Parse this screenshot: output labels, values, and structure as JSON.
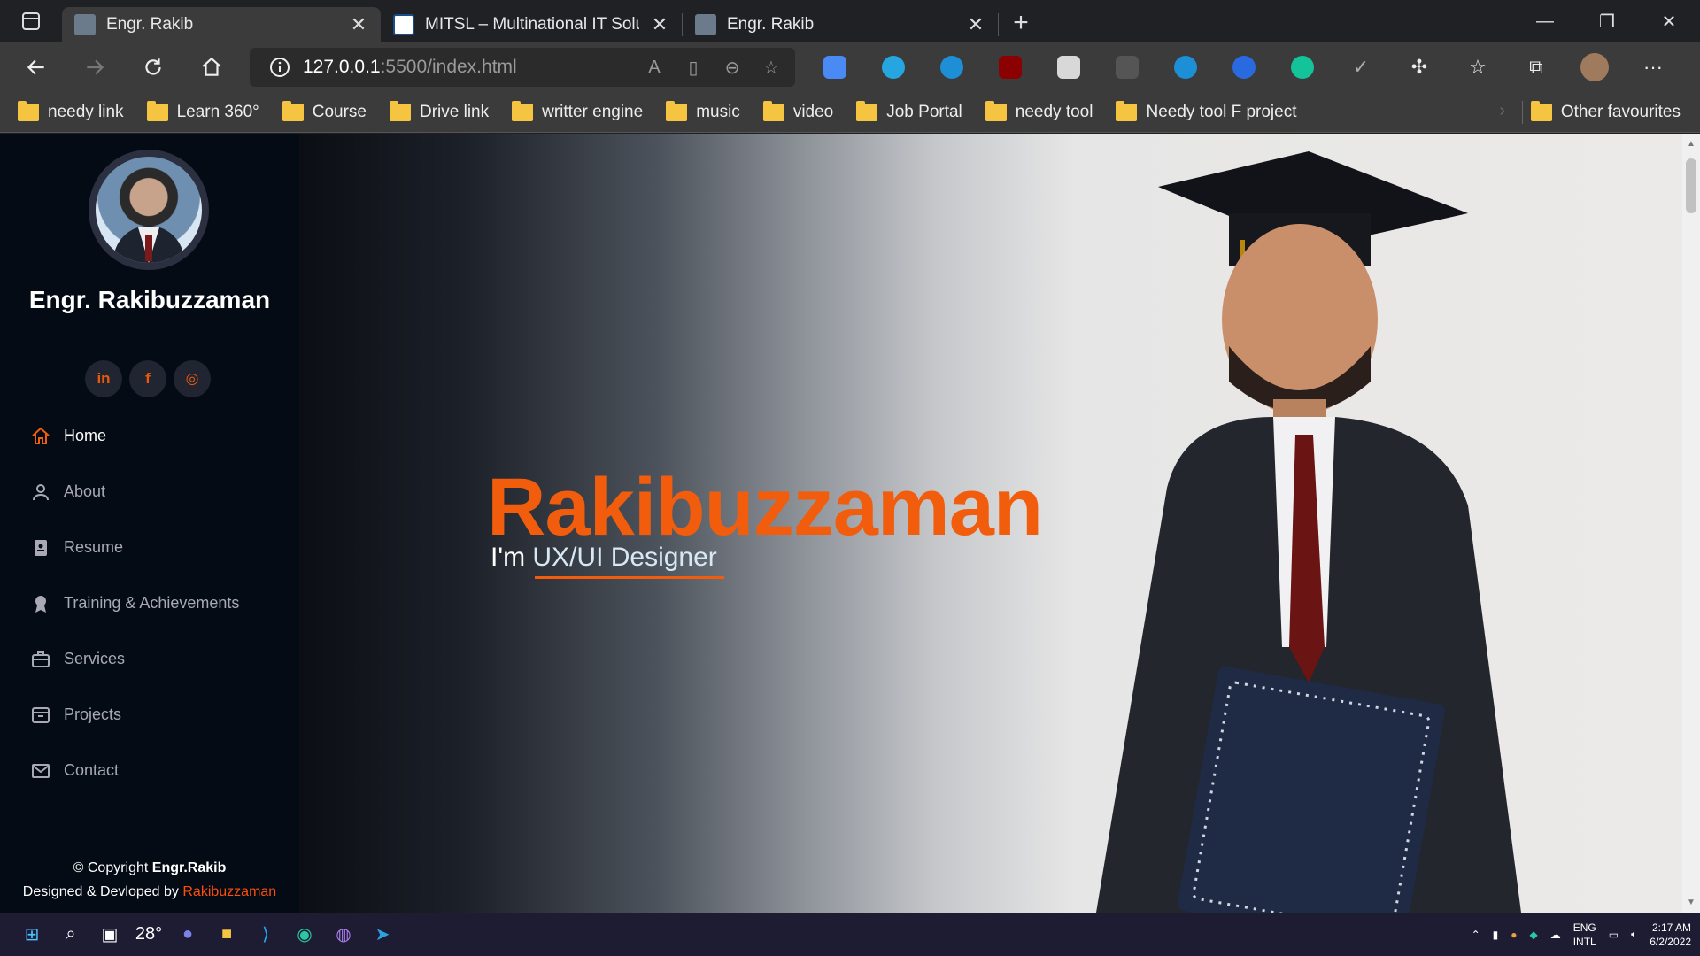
{
  "browser": {
    "tabs": [
      {
        "title": "Engr. Rakib",
        "active": true
      },
      {
        "title": "MITSL – Multinational IT Solution",
        "active": false
      },
      {
        "title": "Engr. Rakib",
        "active": false
      }
    ],
    "url_host": "127.0.0.1",
    "url_rest": ":5500/index.html",
    "bookmarks": [
      "needy link",
      "Learn 360°",
      "Course",
      "Drive link",
      "writter engine",
      "music",
      "video",
      "Job Portal",
      "needy tool",
      "Needy tool F project"
    ],
    "other_favourites": "Other favourites"
  },
  "sidebar": {
    "name": "Engr. Rakibuzzaman",
    "socials": [
      {
        "icon": "linkedin-icon",
        "glyph": "in"
      },
      {
        "icon": "facebook-icon",
        "glyph": "f"
      },
      {
        "icon": "instagram-icon",
        "glyph": "◎"
      }
    ],
    "menu": [
      {
        "label": "Home",
        "icon": "home-icon",
        "active": true
      },
      {
        "label": "About",
        "icon": "user-icon",
        "active": false
      },
      {
        "label": "Resume",
        "icon": "resume-icon",
        "active": false
      },
      {
        "label": "Training & Achievements",
        "icon": "award-icon",
        "active": false
      },
      {
        "label": "Services",
        "icon": "briefcase-icon",
        "active": false
      },
      {
        "label": "Projects",
        "icon": "archive-icon",
        "active": false
      },
      {
        "label": "Contact",
        "icon": "envelope-icon",
        "active": false
      }
    ],
    "footer": {
      "copyright_prefix": "© Copyright ",
      "copyright_name": "Engr.Rakib",
      "designed_prefix": "Designed & Devloped by ",
      "designed_by": "Rakibuzzaman"
    }
  },
  "hero": {
    "title": "Rakibuzzaman",
    "sub_prefix": "I'm ",
    "role": "UX/UI Designer"
  },
  "taskbar": {
    "weather": "28°",
    "lang_line1": "ENG",
    "lang_line2": "INTL",
    "time": "2:17 AM",
    "date": "6/2/2022"
  },
  "colors": {
    "accent": "#f15d0c",
    "sidebar_bg": "#040b14"
  }
}
